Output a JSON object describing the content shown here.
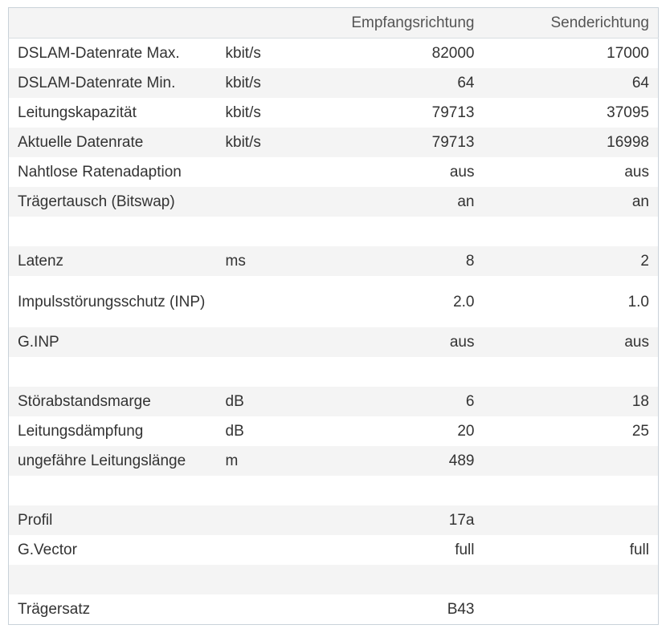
{
  "header": {
    "col_label": "",
    "col_unit": "",
    "col_down": "Empfangsrichtung",
    "col_up": "Senderichtung"
  },
  "rows": [
    {
      "label": "DSLAM-Datenrate Max.",
      "unit": "kbit/s",
      "down": "82000",
      "up": "17000"
    },
    {
      "label": "DSLAM-Datenrate Min.",
      "unit": "kbit/s",
      "down": "64",
      "up": "64"
    },
    {
      "label": "Leitungskapazität",
      "unit": "kbit/s",
      "down": "79713",
      "up": "37095"
    },
    {
      "label": "Aktuelle Datenrate",
      "unit": "kbit/s",
      "down": "79713",
      "up": "16998"
    },
    {
      "label": "Nahtlose Ratenadaption",
      "unit": "",
      "down": "aus",
      "up": "aus"
    },
    {
      "label": "Trägertausch (Bitswap)",
      "unit": "",
      "down": "an",
      "up": "an"
    },
    {
      "label": "",
      "unit": "",
      "down": "",
      "up": ""
    },
    {
      "label": "Latenz",
      "unit": "ms",
      "down": "8",
      "up": "2"
    },
    {
      "label": "Impulsstörungsschutz (INP)",
      "unit": "",
      "down": "2.0",
      "up": "1.0"
    },
    {
      "label": "G.INP",
      "unit": "",
      "down": "aus",
      "up": "aus"
    },
    {
      "label": "",
      "unit": "",
      "down": "",
      "up": ""
    },
    {
      "label": "Störabstandsmarge",
      "unit": "dB",
      "down": "6",
      "up": "18"
    },
    {
      "label": "Leitungsdämpfung",
      "unit": "dB",
      "down": "20",
      "up": "25"
    },
    {
      "label": "ungefähre Leitungslänge",
      "unit": "m",
      "down": "489",
      "up": ""
    },
    {
      "label": "",
      "unit": "",
      "down": "",
      "up": ""
    },
    {
      "label": "Profil",
      "unit": "",
      "down": "17a",
      "up": ""
    },
    {
      "label": "G.Vector",
      "unit": "",
      "down": "full",
      "up": "full"
    },
    {
      "label": "",
      "unit": "",
      "down": "",
      "up": ""
    },
    {
      "label": "Trägersatz",
      "unit": "",
      "down": "B43",
      "up": ""
    }
  ]
}
